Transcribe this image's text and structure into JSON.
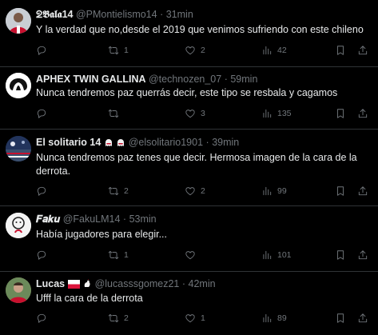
{
  "tweets": [
    {
      "name": "ᘖ𝕭𝖆𝖑𝖆14",
      "handle": "@PMontielismo14",
      "sep": "·",
      "time": "31min",
      "text": "Y la verdad que no,desde el 2019 que venimos sufriendo con este chileno",
      "reply_count": "",
      "retweet_count": "1",
      "like_count": "2",
      "view_count": "42",
      "avatar": "avatar-red-jersey"
    },
    {
      "name": "APHEX TWIN GALLINA",
      "handle": "@technozen_07",
      "sep": "·",
      "time": "59min",
      "text": "Nunca tendremos paz querrás decir, este tipo se resbala y cagamos",
      "reply_count": "",
      "retweet_count": "",
      "like_count": "3",
      "view_count": "135",
      "avatar": "avatar-aphex-logo"
    },
    {
      "name": "El solitario 14",
      "handle": "@elsolitario1901",
      "sep": "·",
      "time": "39min",
      "text": "Nunca tendremos paz tenes que decir. Hermosa imagen de la cara de la derrota.",
      "reply_count": "",
      "retweet_count": "2",
      "like_count": "2",
      "view_count": "99",
      "avatar": "avatar-stadium"
    },
    {
      "name": "𝑭𝒂𝒌𝒖",
      "handle": "@FakuLM14",
      "sep": "·",
      "time": "53min",
      "text": "Había jugadores para elegir...",
      "reply_count": "",
      "retweet_count": "1",
      "like_count": "",
      "view_count": "101",
      "avatar": "avatar-drawing"
    },
    {
      "name": "Lucas",
      "handle": "@lucasssgomez21",
      "sep": "·",
      "time": "42min",
      "text": "Ufff la cara de la derrota",
      "reply_count": "",
      "retweet_count": "2",
      "like_count": "1",
      "view_count": "89",
      "avatar": "avatar-photo"
    }
  ],
  "colors": {
    "background": "#000000",
    "text": "#e7e9ea",
    "secondary": "#71767b",
    "divider": "#2f3336"
  },
  "icons": [
    "reply-icon",
    "retweet-icon",
    "like-icon",
    "views-icon",
    "bookmark-icon",
    "share-icon"
  ]
}
